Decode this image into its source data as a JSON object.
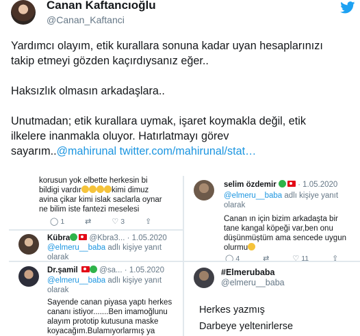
{
  "author": {
    "name": "Canan Kaftancıoğlu",
    "handle": "@Canan_Kaftanci"
  },
  "icons": {
    "brand": "twitter-bird-icon",
    "reply": "reply-icon",
    "retweet": "retweet-icon",
    "like": "like-icon",
    "share": "share-icon"
  },
  "colors": {
    "link": "#1b95e0",
    "brand": "#1da1f2",
    "muted": "#657786"
  },
  "tweet": {
    "line1": "Yardımcı olayım, etik kurallara sonuna kadar uyan hesaplarınızı",
    "line2": "takip etmeyi gözden kaçırdıysanız eğer..",
    "line3": "Haksızlık olmasın arkadaşlara..",
    "line4": "Unutmadan; etik kurallara uymak,  işaret koymakla değil, etik",
    "line5": "ilkelere inanmakla oluyor. Hatırlatmayı görev",
    "line6_text": "sayarım..",
    "mention": "@mahirunal",
    "link": "twitter.com/mahirunal/stat…"
  },
  "screenshot": {
    "card1": {
      "l1": "korusun yok elbette herkesin bi",
      "l2": "bildigi vardır",
      "l2b": "kimi dimuz",
      "l3": "avina çikar kimi islak saclarla oynar",
      "l4": "ne bilim iste fantezi meselesi",
      "replies": "1",
      "retweets": "",
      "likes": "3"
    },
    "card2": {
      "name": "selim özdemir",
      "date": "1.05.2020",
      "reply_to": "@elmeru__baba",
      "reply_suffix": "adlı kişiye yanıt",
      "reply_suffix2": "olarak",
      "l1": "Canan ın için bizim arkadaşta bir",
      "l2": "tane kangal köpeği var,ben onu",
      "l3": "düşünmüştüm ama sencede uygun",
      "l4": "olurmu",
      "replies": "4",
      "retweets": "",
      "likes": "11"
    },
    "card3": {
      "name": "Kübra",
      "handle": "@Kbra3...",
      "date": "1.05.2020",
      "reply_to": "@elmeru__baba",
      "reply_suffix": "adlı kişiye yanıt",
      "reply_suffix2": "olarak"
    },
    "card4": {
      "name": "Dr.şamil",
      "handle": "@sa...",
      "date": "1.05.2020",
      "reply_to": "@elmeru__baba",
      "reply_suffix": "adlı kişiye yanıt",
      "reply_suffix2": "olarak",
      "l1": "Sayende canan piyasa yaptı herkes",
      "l2": "cananı istiyor.......Ben imamoğlunu",
      "l3": "alayım prototip kutusuna maske",
      "l4": "koyacağım.Bulamıyorlarmış ya"
    },
    "card5": {
      "name": "#Elmerubaba",
      "handle": "@elmeru__baba",
      "l1": "Herkes yazmış",
      "l2": "Darbeye yeltenirlerse"
    }
  }
}
